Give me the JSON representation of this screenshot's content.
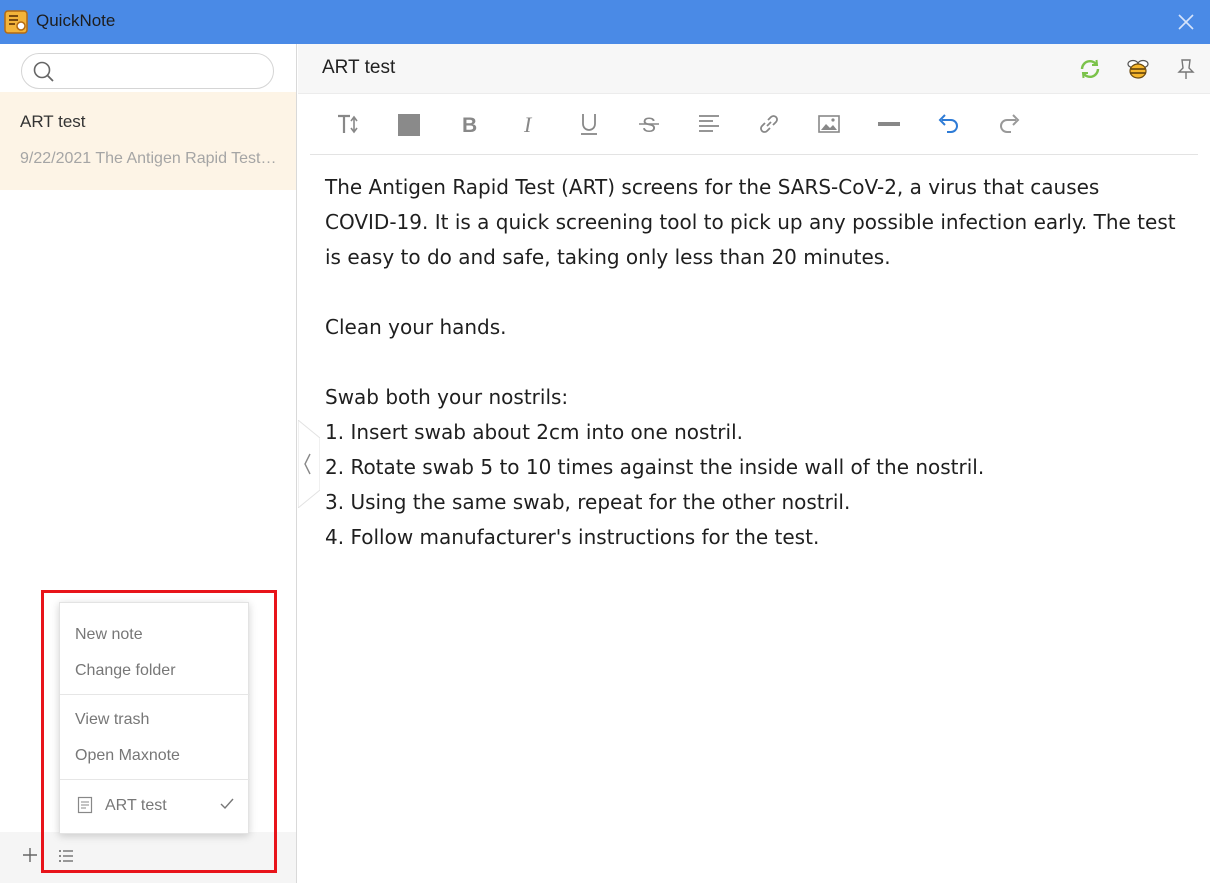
{
  "window": {
    "title": "QuickNote"
  },
  "search": {
    "placeholder": ""
  },
  "note_list": [
    {
      "title": "ART test",
      "snippet": "9/22/2021 The Antigen Rapid Test (ART) screens for the SARS-CoV-2, a virus that causes"
    }
  ],
  "current_note": {
    "title": "ART test"
  },
  "editor": {
    "lines": [
      "The Antigen Rapid Test (ART) screens for the SARS-CoV-2, a virus that causes",
      "COVID-19. It is a quick screening tool to pick up any possible infection early. The test",
      "is easy to do and safe, taking only less than 20 minutes.",
      "",
      "Clean your hands.",
      "",
      "Swab both your nostrils:",
      "1. Insert swab about 2cm into one nostril.",
      "2. Rotate swab 5 to 10 times against the inside wall of the nostril.",
      "3. Using the same swab, repeat for the other nostril.",
      "4. Follow manufacturer's instructions for the test."
    ]
  },
  "menu": {
    "new_note": "New note",
    "change_folder": "Change folder",
    "view_trash": "View trash",
    "open_maxnote": "Open Maxnote",
    "current_folder": "ART test"
  },
  "toolbar_icons": [
    "font-size-icon",
    "text-color-icon",
    "bold-icon",
    "italic-icon",
    "underline-icon",
    "strikethrough-icon",
    "align-icon",
    "link-icon",
    "image-icon",
    "divider-icon",
    "undo-icon",
    "redo-icon"
  ],
  "header_icons": [
    "sync-icon",
    "bee-icon",
    "pin-icon"
  ],
  "colors": {
    "titlebar": "#4a8ae6",
    "selected_note_bg": "#fdf4e6",
    "highlight": "#e8141a",
    "sync_green": "#7bc24a",
    "undo_blue": "#2e7bd6"
  }
}
